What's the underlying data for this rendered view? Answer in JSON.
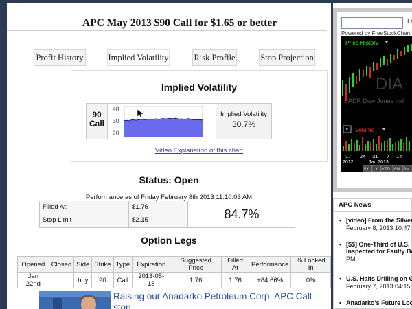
{
  "page": {
    "title": "APC May 2013 $90 Call for $1.65 or better"
  },
  "tabs": [
    {
      "label": "Profit History"
    },
    {
      "label": "Implied Volatility"
    },
    {
      "label": "Risk Profile"
    },
    {
      "label": "Stop Projection"
    }
  ],
  "iv": {
    "title": "Implied Volatility",
    "option_label_1": "90",
    "option_label_2": "Call",
    "value_label": "Implied Volatility",
    "value": "30.7%",
    "video_link": "Video Explanation of this chart"
  },
  "chart_data": {
    "type": "area",
    "title": "",
    "xlabel": "",
    "ylabel": "",
    "y_ticks": [
      "40",
      "30",
      "20"
    ],
    "ylim": [
      17,
      42
    ],
    "values": [
      30.2,
      30.5,
      30.1,
      30.8,
      31.0,
      30.6,
      30.9,
      31.2,
      31.4,
      31.0,
      31.3,
      31.6,
      31.2,
      31.5,
      31.8,
      31.4,
      31.7,
      32.0,
      31.6,
      31.9,
      32.1,
      31.8,
      32.2,
      31.9,
      31.5,
      31.8,
      31.3,
      31.6,
      31.9,
      31.4,
      30.9,
      31.2,
      30.8,
      31.1,
      30.7
    ],
    "fill": "#6a6aee",
    "line": "#1a1a7a"
  },
  "status": {
    "heading": "Status: Open",
    "perf_date": "Performance as of Friday February 8th 2013 11:10:03 AM",
    "filled_label": "Filled At:",
    "filled_value": "$1.76",
    "stop_label": "Stop Limit",
    "stop_value": "$2.15",
    "performance": "84.7%"
  },
  "legs": {
    "heading": "Option Legs",
    "headers": [
      "Opened",
      "Closed",
      "Side",
      "Strike",
      "Type",
      "Expiration",
      "Suggested Price",
      "Filled At",
      "Performance",
      "% Locked In"
    ],
    "rows": [
      [
        "Jan 22nd",
        "",
        "buy",
        "90",
        "Call",
        "2013-05-18",
        "1.76",
        "1.76",
        "+84.66%",
        "0%"
      ]
    ]
  },
  "article": {
    "title": "Raising our Anadarko Petroleum Corp. APC Call stop"
  },
  "sidebar": {
    "search_suffix": "D",
    "powered_by": "Powered by FreeStockChart",
    "price_history": "Price History",
    "watermark": "DIA",
    "ticker_name": "SPDR Dow Jones Ind",
    "volume_label": "Volume",
    "date_labels": [
      "17",
      "24",
      "31",
      "7",
      "14"
    ],
    "month_label": "Jan 2013",
    "year_label": "2012",
    "range_buttons": [
      "5Y",
      "1Y",
      "YTD",
      "6M",
      "3M"
    ],
    "news_title": "APC News",
    "news": [
      {
        "title": "[video] From the Silver",
        "date": "February 8, 2013 10:47"
      },
      {
        "title": "[$$] One-Third of U.S.",
        "title2": "Inspected for Faulty Bo",
        "date": "PM"
      },
      {
        "title": "U.S. Halts Drilling on G",
        "date": "February 7, 2013 04:15"
      },
      {
        "title": "Anadarko's Future Loo",
        "date": ""
      }
    ]
  }
}
